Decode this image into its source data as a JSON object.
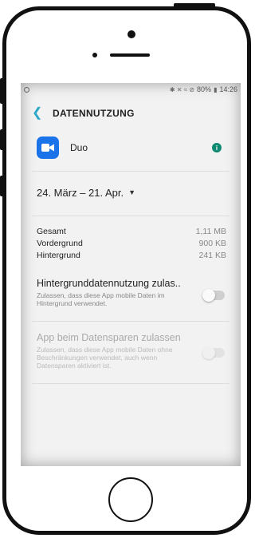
{
  "status_bar": {
    "icons": "✱ ✕ ≈ ⊘",
    "battery": "80%",
    "time": "14:26"
  },
  "app_bar": {
    "back_icon": "arrow-left-icon",
    "title": "DATENNUTZUNG"
  },
  "app": {
    "name": "Duo",
    "icon": "video-camera-icon",
    "info_icon": "info-icon",
    "colors": {
      "duo_blue": "#1a73e8",
      "info_green": "#0e8a72",
      "accent": "#2ea8c8"
    }
  },
  "date_range": {
    "label": "24. März – 21. Apr.",
    "dropdown_icon": "caret-down-icon"
  },
  "usage": [
    {
      "label": "Gesamt",
      "value": "1,11 MB"
    },
    {
      "label": "Vordergrund",
      "value": "900 KB"
    },
    {
      "label": "Hintergrund",
      "value": "241 KB"
    }
  ],
  "settings": [
    {
      "title": "Hintergrunddatennutzung zulas..",
      "description": "Zulassen, dass diese App mobile Daten im Hintergrund verwendet.",
      "enabled": true,
      "checked": false
    },
    {
      "title": "App beim Datensparen zulassen",
      "description": "Zulassen, dass diese App mobile Daten ohne Beschränkungen verwendet, auch wenn Datensparen aktiviert ist.",
      "enabled": false,
      "checked": false
    }
  ]
}
